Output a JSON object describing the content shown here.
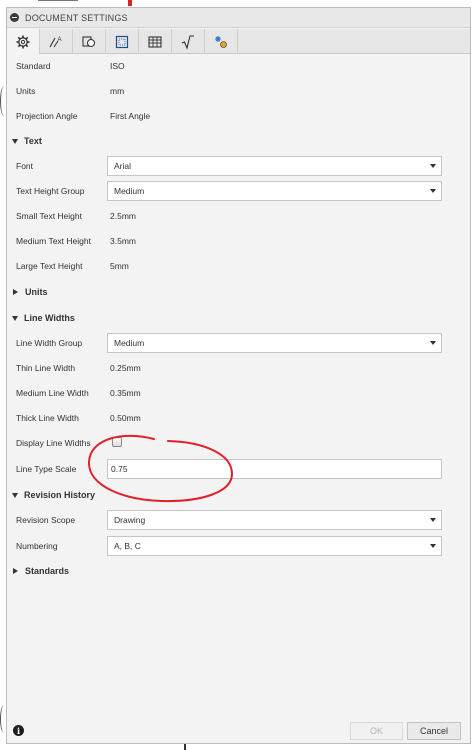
{
  "dialog": {
    "title": "DOCUMENT SETTINGS"
  },
  "tabs": [
    {
      "icon": "gear-icon"
    },
    {
      "icon": "dimension-icon"
    },
    {
      "icon": "shapes-icon"
    },
    {
      "icon": "frame-icon"
    },
    {
      "icon": "table-icon"
    },
    {
      "icon": "sqrt-icon"
    },
    {
      "icon": "settings-star-icon"
    }
  ],
  "general": {
    "standard_label": "Standard",
    "standard_value": "ISO",
    "units_label": "Units",
    "units_value": "mm",
    "projection_label": "Projection Angle",
    "projection_value": "First Angle"
  },
  "text_section": {
    "title": "Text",
    "font_label": "Font",
    "font_value": "Arial",
    "height_group_label": "Text Height Group",
    "height_group_value": "Medium",
    "small_label": "Small Text Height",
    "small_value": "2.5mm",
    "medium_label": "Medium Text Height",
    "medium_value": "3.5mm",
    "large_label": "Large Text Height",
    "large_value": "5mm"
  },
  "units_section": {
    "title": "Units"
  },
  "line_widths_section": {
    "title": "Line Widths",
    "group_label": "Line Width Group",
    "group_value": "Medium",
    "thin_label": "Thin Line Width",
    "thin_value": "0.25mm",
    "medium_label": "Medium Line Width",
    "medium_value": "0.35mm",
    "thick_label": "Thick Line Width",
    "thick_value": "0.50mm",
    "display_label": "Display Line Widths",
    "display_checked": false,
    "type_scale_label": "Line Type Scale",
    "type_scale_value": "0.75"
  },
  "revision_section": {
    "title": "Revision History",
    "scope_label": "Revision Scope",
    "scope_value": "Drawing",
    "numbering_label": "Numbering",
    "numbering_value": "A, B, C"
  },
  "standards_section": {
    "title": "Standards"
  },
  "footer": {
    "info_glyph": "i",
    "ok_label": "OK",
    "ok_enabled": false,
    "cancel_label": "Cancel"
  },
  "colors": {
    "annotation": "#e0202a"
  }
}
